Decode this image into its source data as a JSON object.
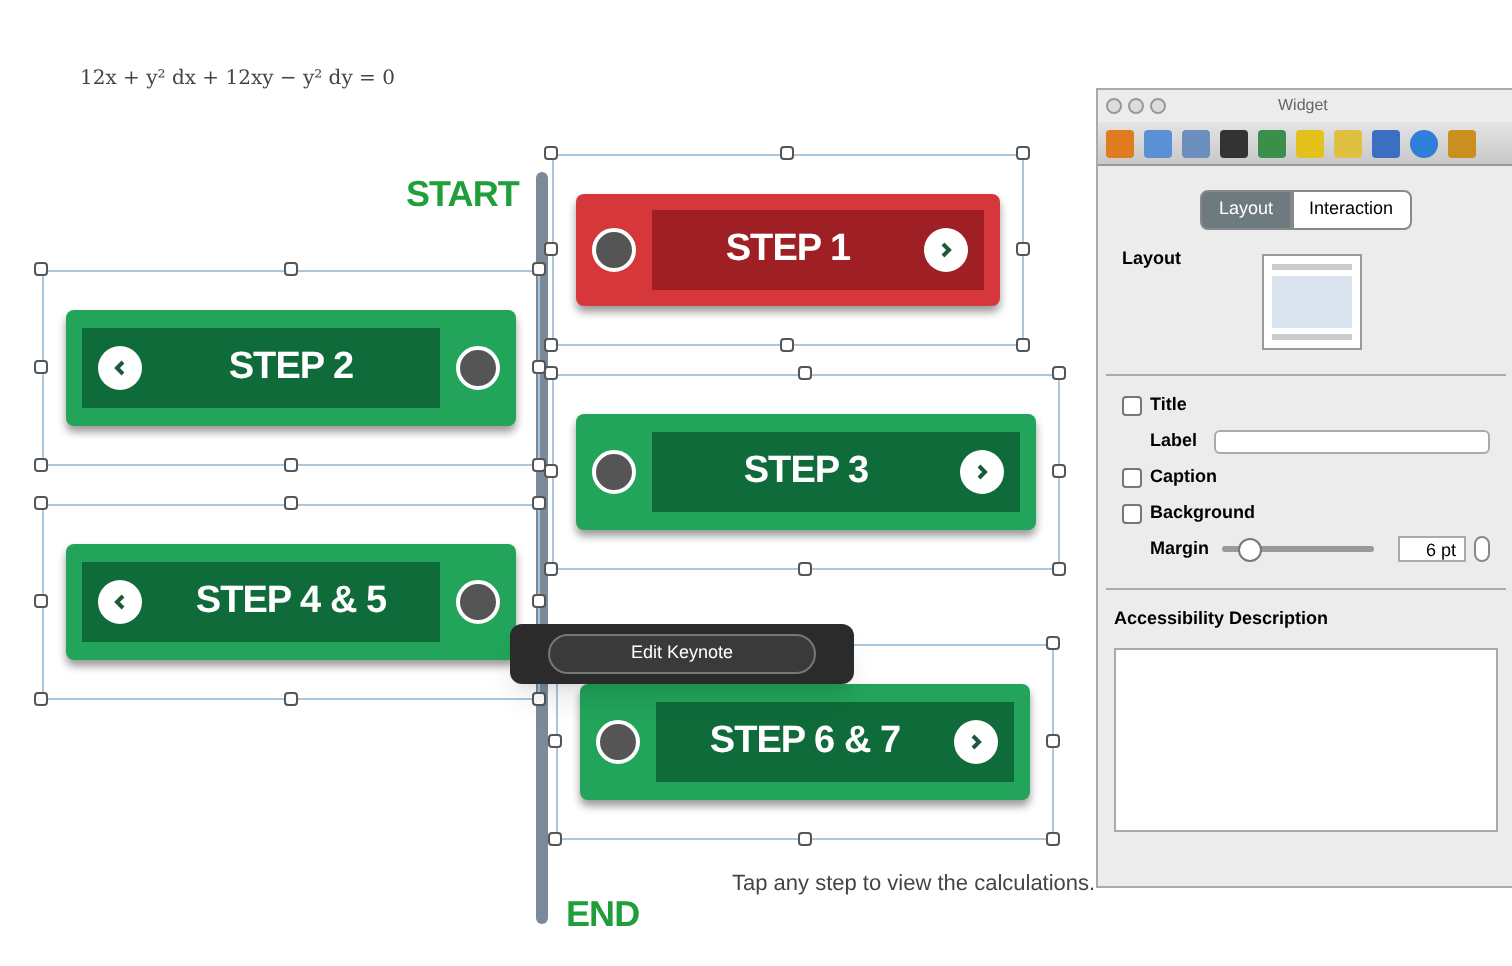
{
  "formula": "12x + y² dx + 12xy − y² dy = 0",
  "timeline": {
    "start": "START",
    "end": "END"
  },
  "steps": [
    {
      "label": "STEP 1",
      "kind": "forward",
      "selected": true
    },
    {
      "label": "STEP 2",
      "kind": "back",
      "selected": false
    },
    {
      "label": "STEP 3",
      "kind": "forward",
      "selected": false
    },
    {
      "label": "STEP 4 & 5",
      "kind": "back",
      "selected": false
    },
    {
      "label": "STEP 6 & 7",
      "kind": "forward",
      "selected": false
    }
  ],
  "popover": {
    "button": "Edit Keynote"
  },
  "caption": "Tap any step to view the calculations.",
  "inspector": {
    "title": "Widget",
    "tabs": [
      {
        "label": "Layout",
        "selected": true
      },
      {
        "label": "Interaction",
        "selected": false
      }
    ],
    "layout_label": "Layout",
    "options": [
      {
        "kind": "checkbox",
        "label": "Title",
        "checked": false
      },
      {
        "kind": "field",
        "label": "Label"
      },
      {
        "kind": "checkbox",
        "label": "Caption",
        "checked": false
      },
      {
        "kind": "checkbox",
        "label": "Background",
        "checked": false
      },
      {
        "kind": "slider",
        "label": "Margin",
        "level": 0.12,
        "value": "6 pt"
      }
    ],
    "accessibility_label": "Accessibility Description"
  }
}
